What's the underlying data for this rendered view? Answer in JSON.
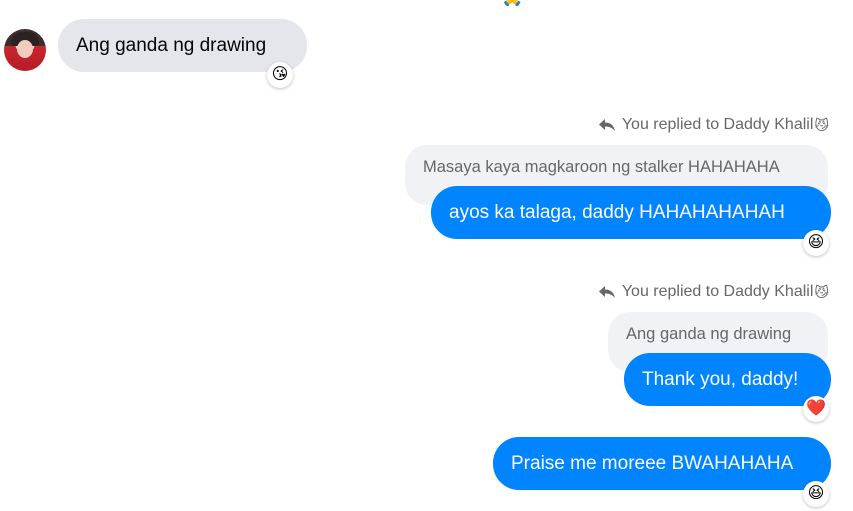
{
  "messages": {
    "incoming_1": {
      "text": "Ang ganda ng drawing",
      "reaction": "😘"
    },
    "reply_1": {
      "label": "You replied to Daddy Khalil",
      "label_emoji": "😼",
      "quoted": "Masaya kaya magkaroon ng stalker HAHAHAHA",
      "text": "ayos ka talaga, daddy HAHAHAHAHAH",
      "reaction": "😆"
    },
    "reply_2": {
      "label": "You replied to Daddy Khalil",
      "label_emoji": "😼",
      "quoted": "Ang ganda ng drawing",
      "text": "Thank you, daddy!",
      "reaction": "❤️"
    },
    "outgoing_3": {
      "text": "Praise me moreee BWAHAHAHA",
      "reaction": "😆"
    }
  },
  "top_partial_emoji": "🙏",
  "colors": {
    "outgoing_bubble": "#0084ff",
    "incoming_bubble": "#e4e6eb",
    "quoted_bubble": "#f0f2f5",
    "meta_text": "#65676b"
  }
}
